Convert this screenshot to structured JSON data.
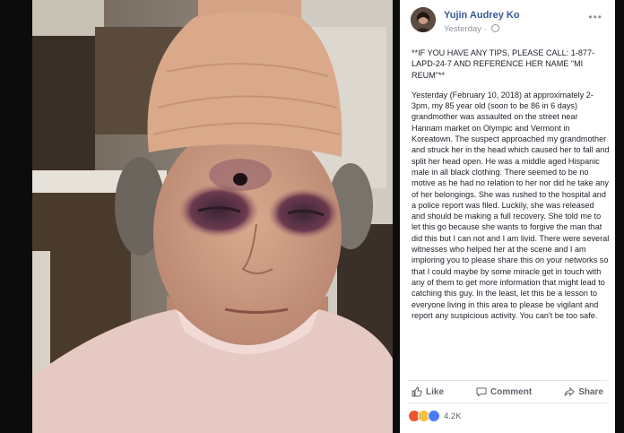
{
  "post": {
    "author": "Yujin Audrey Ko",
    "timestamp": "Yesterday · ",
    "more_icon": "ellipsis-icon",
    "notice": "**IF YOU HAVE ANY TIPS, PLEASE CALL: 1-877-LAPD-24-7 AND REFERENCE HER NAME \"MI REUM\"**",
    "body": "Yesterday (February 10, 2018) at approximately 2-3pm, my 85 year old (soon to be 86 in 6 days) grandmother was assaulted on the street near Hannam market on Olympic and Vermont in Koreatown. The suspect approached my grandmother and struck her in the head which caused her to fall and split her head open. He was a middle aged Hispanic male in all black clothing. There seemed to be no motive as he had no relation to her nor did he take any of her belongings. She was rushed to the hospital and a police report was filed. Luckily, she was released and should be making a full recovery. She told me to let this go because she wants to forgive the man that did this but I can not and I am livid. There were several witnesses who helped her at the scene and I am imploring you to please share this on your networks so that I could maybe by some miracle get in touch with any of them to get more information that might lead to catching this guy. In the least, let this be a lesson to everyone living in this area to please be vigilant and report any suspicious activity. You can't be too safe."
  },
  "actions": {
    "like": "Like",
    "comment": "Comment",
    "share": "Share"
  },
  "reactions": {
    "count": "4.2K",
    "types": [
      "angry",
      "sad",
      "like"
    ]
  },
  "colors": {
    "author_link": "#365899",
    "action_text": "#606770",
    "like_blue": "#4a7cf5"
  }
}
